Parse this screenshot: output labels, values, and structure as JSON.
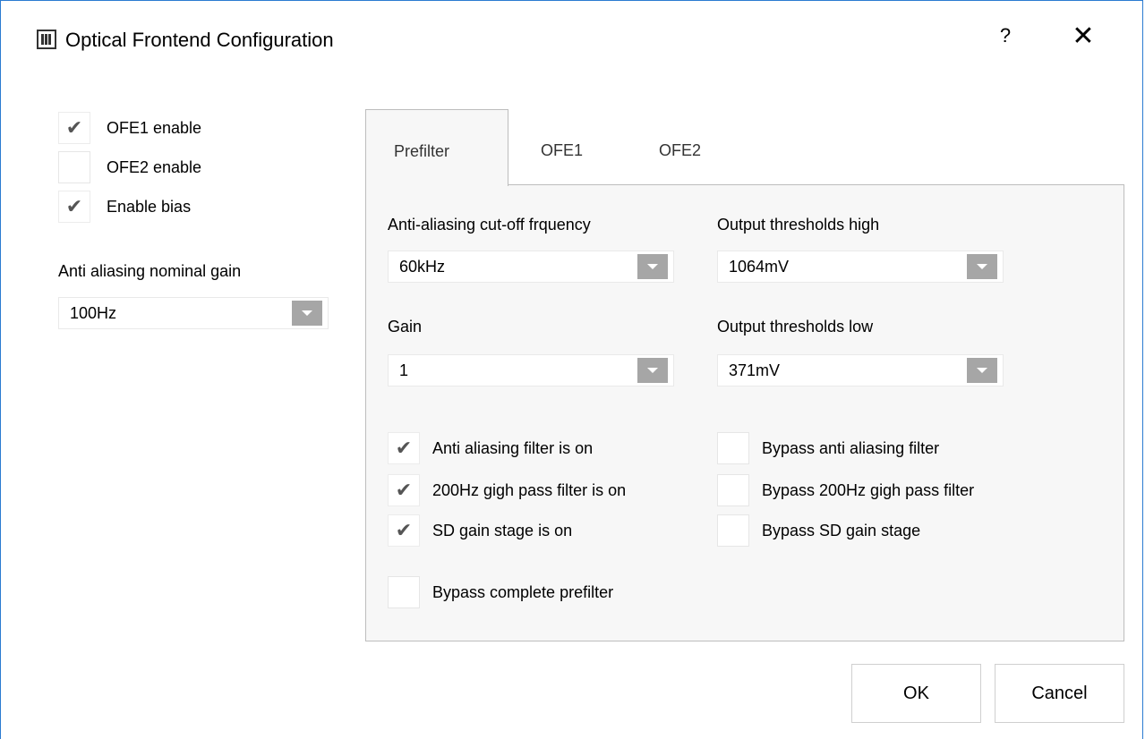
{
  "window": {
    "title": "Optical Frontend Configuration",
    "help_label": "?",
    "close_label": "✕"
  },
  "left_panel": {
    "checkboxes": [
      {
        "label": "OFE1 enable",
        "checked": true
      },
      {
        "label": "OFE2 enable",
        "checked": false
      },
      {
        "label": "Enable bias",
        "checked": true
      }
    ],
    "gain_label": "Anti aliasing nominal gain",
    "gain_value": "100Hz"
  },
  "tabs": [
    {
      "label": "Prefilter",
      "active": true
    },
    {
      "label": "OFE1",
      "active": false
    },
    {
      "label": "OFE2",
      "active": false
    }
  ],
  "prefilter": {
    "cutoff_label": "Anti-aliasing cut-off frquency",
    "cutoff_value": "60kHz",
    "thresh_high_label": "Output thresholds high",
    "thresh_high_value": "1064mV",
    "gain_label": "Gain",
    "gain_value": "1",
    "thresh_low_label": "Output thresholds low",
    "thresh_low_value": "371mV",
    "left_checks": [
      {
        "label": "Anti aliasing filter is on",
        "checked": true
      },
      {
        "label": "200Hz gigh pass filter is on",
        "checked": true
      },
      {
        "label": "SD gain stage is on",
        "checked": true
      }
    ],
    "right_checks": [
      {
        "label": "Bypass anti aliasing filter",
        "checked": false
      },
      {
        "label": "Bypass 200Hz gigh pass filter",
        "checked": false
      },
      {
        "label": "Bypass SD gain stage",
        "checked": false
      }
    ],
    "bypass_all": {
      "label": "Bypass complete prefilter",
      "checked": false
    }
  },
  "buttons": {
    "ok": "OK",
    "cancel": "Cancel"
  },
  "check_glyph": "✔"
}
